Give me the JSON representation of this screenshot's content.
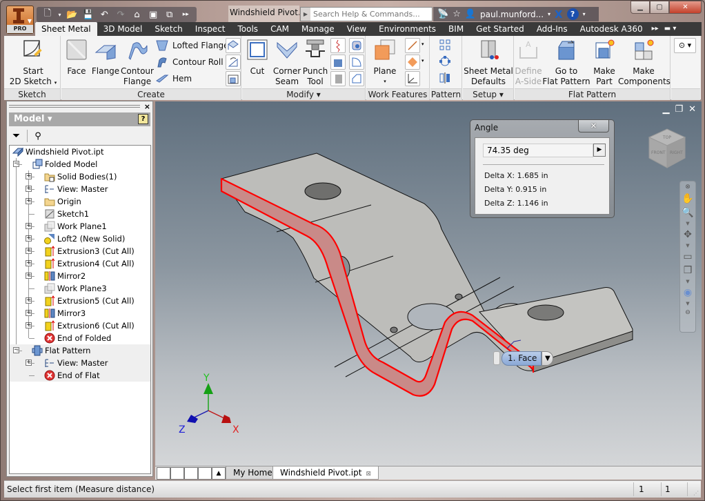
{
  "app": {
    "badge": "PRO",
    "document_title": "Windshield Pivot.i...",
    "search_placeholder": "Search Help & Commands...",
    "user": "paul.munford...",
    "help_label": "?"
  },
  "ribbon_tabs": [
    {
      "label": "Sheet Metal",
      "active": true
    },
    {
      "label": "3D Model"
    },
    {
      "label": "Sketch"
    },
    {
      "label": "Inspect"
    },
    {
      "label": "Tools"
    },
    {
      "label": "CAM"
    },
    {
      "label": "Manage"
    },
    {
      "label": "View"
    },
    {
      "label": "Environments"
    },
    {
      "label": "BIM"
    },
    {
      "label": "Get Started"
    },
    {
      "label": "Add-Ins"
    },
    {
      "label": "Autodesk A360"
    }
  ],
  "ribbon": {
    "sketch": {
      "label": "Sketch",
      "start_line1": "Start",
      "start_line2": "2D Sketch"
    },
    "create": {
      "label": "Create",
      "face": "Face",
      "flange": "Flange",
      "contour1": "Contour",
      "contour2": "Flange",
      "lofted_flange": "Lofted Flange",
      "contour_roll": "Contour Roll",
      "hem": "Hem"
    },
    "modify": {
      "label": "Modify ▾",
      "cut": "Cut",
      "corner1": "Corner",
      "corner2": "Seam",
      "punch1": "Punch",
      "punch2": "Tool"
    },
    "work_features": {
      "label": "Work Features",
      "plane": "Plane"
    },
    "pattern": {
      "label": "Pattern"
    },
    "setup": {
      "label": "Setup ▾",
      "smd1": "Sheet Metal",
      "smd2": "Defaults"
    },
    "flat_pattern": {
      "label": "Flat Pattern",
      "define1": "Define",
      "define2": "A-Side",
      "goto1": "Go to",
      "goto2": "Flat Pattern",
      "makepart1": "Make",
      "makepart2": "Part",
      "makecomp1": "Make",
      "makecomp2": "Components"
    }
  },
  "browser": {
    "title": "Model ▾",
    "help": "?",
    "tree": [
      {
        "label": "Windshield Pivot.ipt",
        "icon": "part-icon",
        "level": 0
      },
      {
        "label": "Folded Model",
        "icon": "folded-model-icon",
        "level": 1,
        "expander": "−"
      },
      {
        "label": "Solid Bodies(1)",
        "icon": "solid-bodies-folder-icon",
        "level": 2,
        "expander": "+"
      },
      {
        "label": "View: Master",
        "icon": "view-icon",
        "level": 2,
        "expander": "+"
      },
      {
        "label": "Origin",
        "icon": "folder-icon",
        "level": 2,
        "expander": "+"
      },
      {
        "label": "Sketch1",
        "icon": "sketch-icon",
        "level": 2
      },
      {
        "label": "Work Plane1",
        "icon": "work-plane-icon",
        "level": 2,
        "expander": "+"
      },
      {
        "label": "Loft2 (New Solid)",
        "icon": "loft-icon",
        "level": 2,
        "expander": "+"
      },
      {
        "label": "Extrusion3 (Cut All)",
        "icon": "extrusion-icon",
        "level": 2,
        "expander": "+"
      },
      {
        "label": "Extrusion4 (Cut All)",
        "icon": "extrusion-icon",
        "level": 2,
        "expander": "+"
      },
      {
        "label": "Mirror2",
        "icon": "mirror-icon",
        "level": 2,
        "expander": "+"
      },
      {
        "label": "Work Plane3",
        "icon": "work-plane-icon",
        "level": 2
      },
      {
        "label": "Extrusion5 (Cut All)",
        "icon": "extrusion-icon",
        "level": 2,
        "expander": "+"
      },
      {
        "label": "Mirror3",
        "icon": "mirror-icon",
        "level": 2,
        "expander": "+"
      },
      {
        "label": "Extrusion6 (Cut All)",
        "icon": "extrusion-icon",
        "level": 2,
        "expander": "+"
      },
      {
        "label": "End of Folded",
        "icon": "end-of-part-icon",
        "level": 2
      },
      {
        "label": "Flat Pattern",
        "icon": "flat-pattern-icon",
        "level": 1,
        "expander": "−",
        "section": "flat"
      },
      {
        "label": "View: Master",
        "icon": "view-icon",
        "level": 2,
        "expander": "+",
        "section": "flat"
      },
      {
        "label": "End of Flat",
        "icon": "end-of-part-icon",
        "level": 2,
        "section": "flat"
      }
    ]
  },
  "angle_dialog": {
    "title": "Angle",
    "value": "74.35 deg",
    "delta_x": "Delta X: 1.685 in",
    "delta_y": "Delta Y: 0.915 in",
    "delta_z": "Delta Z: 1.146 in"
  },
  "selection_chip": {
    "label": "1. Face"
  },
  "triad": {
    "x": "X",
    "y": "Y",
    "z": "Z"
  },
  "viewcube": {
    "top": "TOP",
    "front": "FRONT",
    "right": "RIGHT"
  },
  "doc_tabs": [
    {
      "label": "My Home",
      "active": false
    },
    {
      "label": "Windshield Pivot.ipt",
      "active": true
    }
  ],
  "status": {
    "message": "Select first item (Measure distance)",
    "count1": "1",
    "count2": "1"
  },
  "colors": {
    "highlight_edge": "#ff0000",
    "highlight_fill": "#c98a88",
    "part_face": "#bdbdba",
    "ribbon_tab_bar": "#3a3a3a"
  }
}
